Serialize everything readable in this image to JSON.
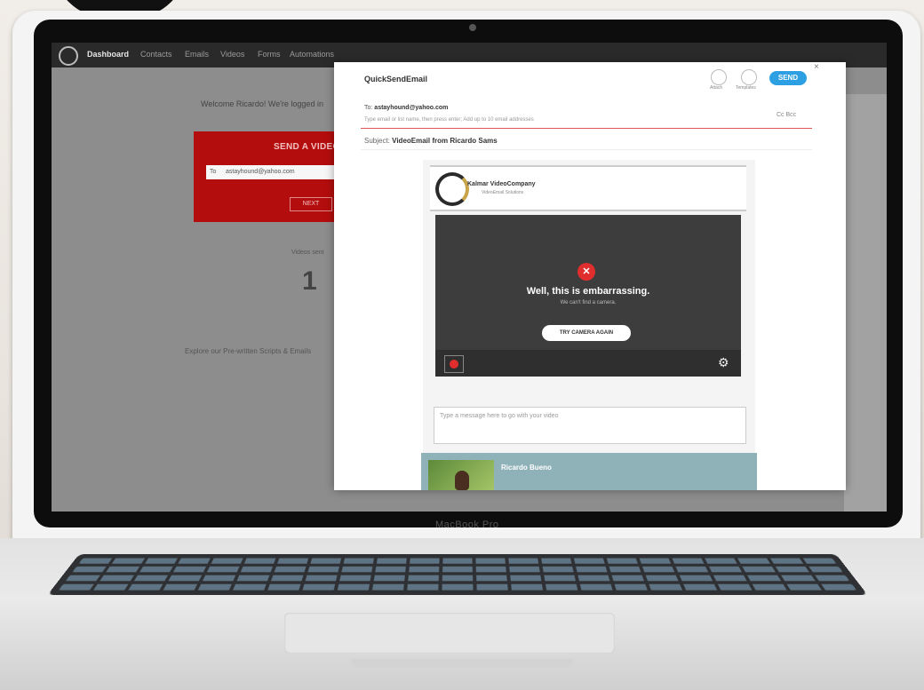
{
  "device": {
    "brand_label": "MacBook Pro"
  },
  "dashboard": {
    "nav": [
      "Dashboard",
      "Contacts",
      "Emails",
      "Videos",
      "Forms",
      "Automations"
    ],
    "welcome_text": "Welcome Ricardo! We're logged in",
    "send_card": {
      "title": "SEND A VIDEO E",
      "to_label": "To",
      "to_value": "astayhound@yahoo.com",
      "next_label": "NEXT"
    },
    "stat": {
      "label": "Videos sent",
      "value": "1"
    },
    "explore_text": "Explore our Pre-written Scripts & Emails"
  },
  "popup": {
    "title": "QuickSendEmail",
    "header_actions": [
      "Attach",
      "Templates"
    ],
    "send_label": "SEND",
    "close_symbol": "×",
    "to_label": "To:",
    "to_value": "astayhound@yahoo.com",
    "hint": "Type email or list name, then press enter; Add up to 10 email addresses",
    "cc_label": "Cc  Bcc",
    "subject_label": "Subject:",
    "subject_value": "VideoEmail from Ricardo Sams",
    "company": {
      "name": "Kalmar VideoCompany",
      "tagline": "VideoEmail Solutions"
    },
    "player": {
      "error_title": "Well, this is embarrassing.",
      "error_sub": "We can't find a camera.",
      "retry_label": "TRY CAMERA AGAIN",
      "error_icon": "x-icon",
      "settings_icon": "gear-icon"
    },
    "message_placeholder": "Type a message here to go with your video",
    "signature_name": "Ricardo Bueno"
  }
}
